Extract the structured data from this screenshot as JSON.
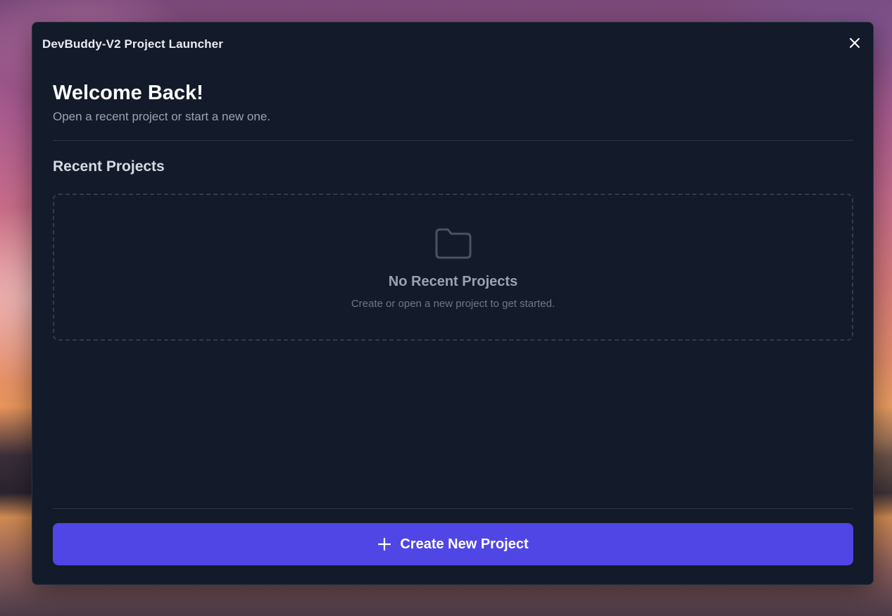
{
  "window": {
    "title": "DevBuddy-V2 Project Launcher",
    "close_icon": "close-icon"
  },
  "welcome": {
    "title": "Welcome Back!",
    "subtitle": "Open a recent project or start a new one."
  },
  "recent": {
    "title": "Recent Projects",
    "empty_icon": "folder-icon",
    "empty_title": "No Recent Projects",
    "empty_subtitle": "Create or open a new project to get started."
  },
  "actions": {
    "create_icon": "plus-icon",
    "create_label": "Create New Project"
  },
  "colors": {
    "window_bg": "#131a29",
    "accent": "#4f46e5",
    "divider": "#2d3544",
    "muted_text": "#9aa3b2"
  }
}
